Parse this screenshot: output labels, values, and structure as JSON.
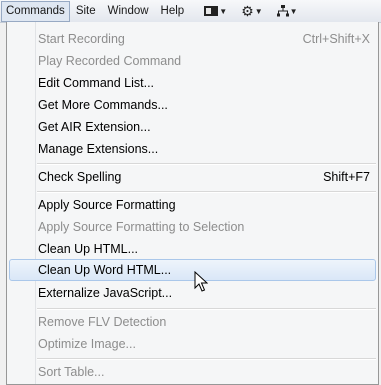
{
  "menubar": {
    "items": [
      {
        "label": "Commands",
        "active": true
      },
      {
        "label": "Site"
      },
      {
        "label": "Window"
      },
      {
        "label": "Help"
      }
    ],
    "icons": [
      "layout-icon",
      "gear-icon",
      "site-icon"
    ]
  },
  "menu": {
    "items": [
      {
        "label": "Start Recording",
        "shortcut": "Ctrl+Shift+X",
        "disabled": true
      },
      {
        "label": "Play Recorded Command",
        "disabled": true
      },
      {
        "label": "Edit Command List..."
      },
      {
        "label": "Get More Commands..."
      },
      {
        "label": "Get AIR Extension..."
      },
      {
        "label": "Manage Extensions..."
      },
      {
        "label": "Check Spelling",
        "shortcut": "Shift+F7"
      },
      {
        "label": "Apply Source Formatting"
      },
      {
        "label": "Apply Source Formatting to Selection",
        "disabled": true
      },
      {
        "label": "Clean Up HTML..."
      },
      {
        "label": "Clean Up Word HTML...",
        "hovered": true
      },
      {
        "label": "Externalize JavaScript..."
      },
      {
        "label": "Remove FLV Detection",
        "disabled": true
      },
      {
        "label": "Optimize Image...",
        "disabled": true
      },
      {
        "label": "Sort Table...",
        "disabled": true
      }
    ]
  }
}
